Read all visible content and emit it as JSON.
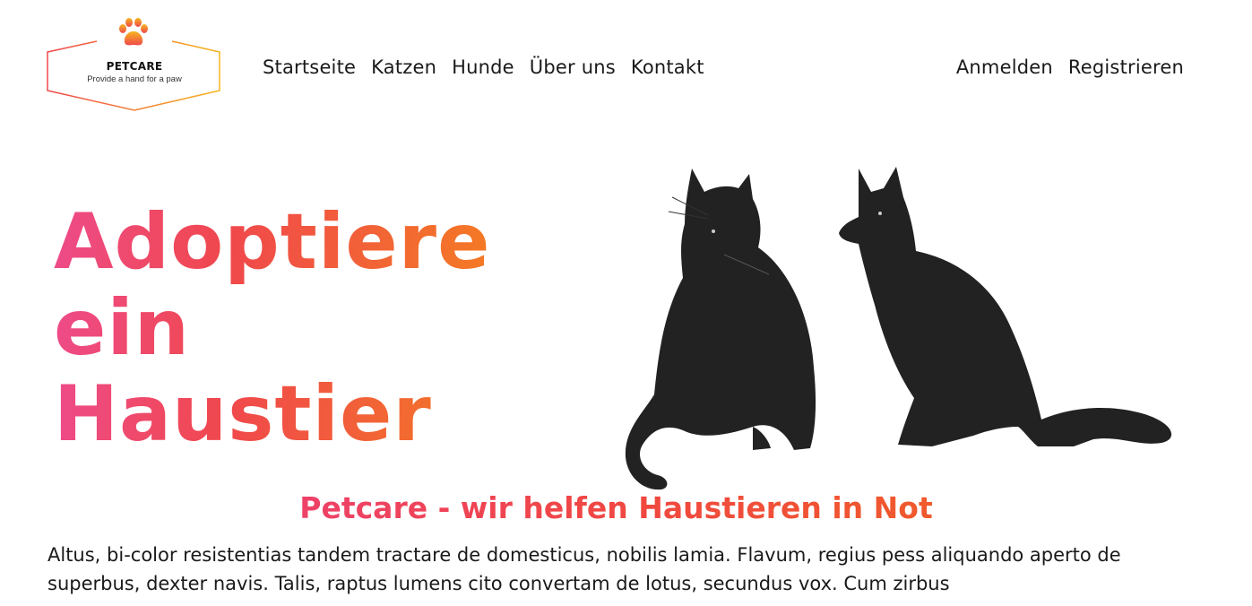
{
  "logo": {
    "icon": "paw-icon",
    "brand": "PETCARE",
    "tagline": "Provide a hand for a paw",
    "accent_start": "#f0484c",
    "accent_end": "#f7b51f"
  },
  "nav": {
    "items": [
      {
        "label": "Startseite"
      },
      {
        "label": "Katzen"
      },
      {
        "label": "Hunde"
      },
      {
        "label": "Über uns"
      },
      {
        "label": "Kontakt"
      }
    ]
  },
  "auth": {
    "login": "Anmelden",
    "register": "Registrieren"
  },
  "hero": {
    "title_lines": [
      "Adoptiere",
      "ein",
      "Haustier"
    ],
    "image": "cat-and-dog-silhouette-image",
    "gradient": [
      "#ee4b8a",
      "#f0484c",
      "#f47a24"
    ]
  },
  "intro": {
    "subtitle": "Petcare - wir helfen Haustieren in Not",
    "text": "Altus, bi-color resistentias tandem tractare de domesticus, nobilis lamia. Flavum, regius pess aliquando aperto de superbus, dexter navis. Talis, raptus lumens cito convertam de lotus, secundus vox. Cum zirbus"
  }
}
